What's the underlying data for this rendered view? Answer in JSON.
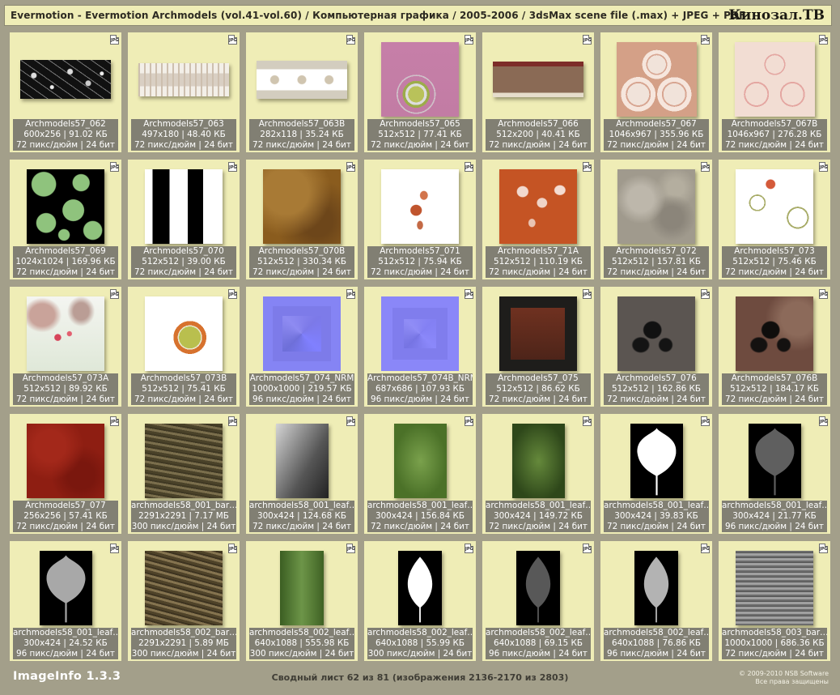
{
  "header": {
    "title": "Evermotion - Evermotion Archmodels (vol.41-vol.60) / Компьютерная графика / 2005-2006 / 3dsMax scene file (.max) + JPEG + PDF",
    "brand": "Кинозал.ТВ"
  },
  "badge_label": "JPG",
  "tiles": [
    {
      "name": "Archmodels57_062",
      "meta": "600x256 | 91.02 КБ",
      "res": "72 пикс/дюйм | 24 бит",
      "aspect": 2.34,
      "preview": "floral-black"
    },
    {
      "name": "Archmodels57_063",
      "meta": "497x180 | 48.40 КБ",
      "res": "72 пикс/дюйм | 24 бит",
      "aspect": 2.76,
      "preview": "border-lace"
    },
    {
      "name": "Archmodels57_063B",
      "meta": "282x118 | 35.24 КБ",
      "res": "72 пикс/дюйм | 24 бит",
      "aspect": 2.39,
      "preview": "border-swirl"
    },
    {
      "name": "Archmodels57_065",
      "meta": "512x512 | 77.41 КБ",
      "res": "72 пикс/дюйм | 24 бит",
      "aspect": 1,
      "preview": "coffee-pink"
    },
    {
      "name": "Archmodels57_066",
      "meta": "512x200 | 40.41 КБ",
      "res": "72 пикс/дюйм | 24 бит",
      "aspect": 2.56,
      "preview": "coffee-banner"
    },
    {
      "name": "Archmodels57_067",
      "meta": "1046x967 | 355.96 КБ",
      "res": "72 пикс/дюйм | 24 бит",
      "aspect": 1.08,
      "preview": "circles-tan"
    },
    {
      "name": "Archmodels57_067B",
      "meta": "1046x967 | 276.28 КБ",
      "res": "72 пикс/дюйм | 24 бит",
      "aspect": 1.08,
      "preview": "circles-light"
    },
    {
      "name": "Archmodels57_069",
      "meta": "1024x1024 | 169.96 КБ",
      "res": "72 пикс/дюйм | 24 бит",
      "aspect": 1,
      "preview": "green-dots"
    },
    {
      "name": "Archmodels57_070",
      "meta": "512x512 | 39.00 КБ",
      "res": "72 пикс/дюйм | 24 бит",
      "aspect": 1,
      "preview": "bw-stripes"
    },
    {
      "name": "Archmodels57_070B",
      "meta": "512x512 | 330.34 КБ",
      "res": "72 пикс/дюйм | 24 бит",
      "aspect": 1,
      "preview": "gold-texture"
    },
    {
      "name": "Archmodels57_071",
      "meta": "512x512 | 75.94 КБ",
      "res": "72 пикс/дюйм | 24 бит",
      "aspect": 1,
      "preview": "white-floral"
    },
    {
      "name": "Archmodels57_71A",
      "meta": "512x512 | 110.19 КБ",
      "res": "72 пикс/дюйм | 24 бит",
      "aspect": 1,
      "preview": "orange-floral"
    },
    {
      "name": "Archmodels57_072",
      "meta": "512x512 | 157.81 КБ",
      "res": "72 пикс/дюйм | 24 бит",
      "aspect": 1,
      "preview": "grey-stone"
    },
    {
      "name": "Archmodels57_073",
      "meta": "512x512 | 75.46 КБ",
      "res": "72 пикс/дюйм | 24 бит",
      "aspect": 1,
      "preview": "white-rose"
    },
    {
      "name": "Archmodels57_073A",
      "meta": "512x512 | 89.92 КБ",
      "res": "72 пикс/дюйм | 24 бит",
      "aspect": 1,
      "preview": "flowers-photo"
    },
    {
      "name": "Archmodels57_073B",
      "meta": "512x512 | 75.41 КБ",
      "res": "72 пикс/дюйм | 24 бит",
      "aspect": 1,
      "preview": "orange-ring"
    },
    {
      "name": "Archmodels57_074_NRM",
      "meta": "1000x1000 | 219.57 КБ",
      "res": "96 пикс/дюйм | 24 бит",
      "aspect": 1,
      "preview": "normal-map"
    },
    {
      "name": "Archmodels57_074B_NRM",
      "meta": "687x686 | 107.93 КБ",
      "res": "96 пикс/дюйм | 24 бит",
      "aspect": 1,
      "preview": "normal-map-b"
    },
    {
      "name": "Archmodels57_075",
      "meta": "512x512 | 86.62 КБ",
      "res": "72 пикс/дюйм | 24 бит",
      "aspect": 1,
      "preview": "rust-frame"
    },
    {
      "name": "Archmodels57_076",
      "meta": "512x512 | 162.86 КБ",
      "res": "72 пикс/дюйм | 24 бит",
      "aspect": 1,
      "preview": "ornament-grey"
    },
    {
      "name": "Archmodels57_076B",
      "meta": "512x512 | 184.17 КБ",
      "res": "72 пикс/дюйм | 24 бит",
      "aspect": 1,
      "preview": "ornament-rust"
    },
    {
      "name": "Archmodels57_077",
      "meta": "256x256 | 57.41 КБ",
      "res": "72 пикс/дюйм | 24 бит",
      "aspect": 1,
      "preview": "red-texture"
    },
    {
      "name": "archmodels58_001_bar…",
      "meta": "2291x2291 | 7.17 МБ",
      "res": "300 пикс/дюйм | 24 бит",
      "aspect": 1,
      "preview": "bark"
    },
    {
      "name": "archmodels58_001_leaf…",
      "meta": "300x424 | 124.68 КБ",
      "res": "72 пикс/дюйм | 24 бит",
      "aspect": 0.71,
      "preview": "leaf-grey"
    },
    {
      "name": "archmodels58_001_leaf…",
      "meta": "300x424 | 156.84 КБ",
      "res": "72 пикс/дюйм | 24 бит",
      "aspect": 0.71,
      "preview": "leaf-green"
    },
    {
      "name": "archmodels58_001_leaf…",
      "meta": "300x424 | 149.72 КБ",
      "res": "72 пикс/дюйм | 24 бит",
      "aspect": 0.71,
      "preview": "leaf-green-dark"
    },
    {
      "name": "archmodels58_001_leaf…",
      "meta": "300x424 | 39.83 КБ",
      "res": "72 пикс/дюйм | 24 бит",
      "aspect": 0.71,
      "preview": "leaf-white"
    },
    {
      "name": "archmodels58_001_leaf…",
      "meta": "300x424 | 21.77 КБ",
      "res": "96 пикс/дюйм | 24 бит",
      "aspect": 0.71,
      "preview": "leaf-darkgrey"
    },
    {
      "name": "archmodels58_001_leaf…",
      "meta": "300x424 | 24.52 КБ",
      "res": "96 пикс/дюйм | 24 бит",
      "aspect": 0.71,
      "preview": "leaf-lightgrey"
    },
    {
      "name": "archmodels58_002_bar…",
      "meta": "2291x2291 | 5.89 МБ",
      "res": "300 пикс/дюйм | 24 бит",
      "aspect": 1,
      "preview": "bark-2"
    },
    {
      "name": "archmodels58_002_leaf…",
      "meta": "640x1088 | 555.98 КБ",
      "res": "300 пикс/дюйм | 24 бит",
      "aspect": 0.59,
      "preview": "leaf-photo"
    },
    {
      "name": "archmodels58_002_leaf…",
      "meta": "640x1088 | 55.99 КБ",
      "res": "300 пикс/дюйм | 24 бит",
      "aspect": 0.59,
      "preview": "leaf2-white"
    },
    {
      "name": "archmodels58_002_leaf…",
      "meta": "640x1088 | 69.15 КБ",
      "res": "96 пикс/дюйм | 24 бит",
      "aspect": 0.59,
      "preview": "leaf2-darkgrey"
    },
    {
      "name": "archmodels58_002_leaf…",
      "meta": "640x1088 | 76.86 КБ",
      "res": "96 пикс/дюйм | 24 бит",
      "aspect": 0.59,
      "preview": "leaf2-lightgrey"
    },
    {
      "name": "archmodels58_003_bar…",
      "meta": "1000x1000 | 686.36 КБ",
      "res": "72 пикс/дюйм | 24 бит",
      "aspect": 1,
      "preview": "bark-grey"
    }
  ],
  "footer": {
    "app": "ImageInfo 1.3.3",
    "sheet": "Сводный лист 62 из 81 (изображения 2136-2170 из 2803)",
    "copyright": "© 2009-2010 NSB Software",
    "rights": "Все права защищены"
  },
  "colors": {
    "background": "#a39f8a",
    "cell": "#efedb6",
    "info_bar": "#817f73"
  }
}
